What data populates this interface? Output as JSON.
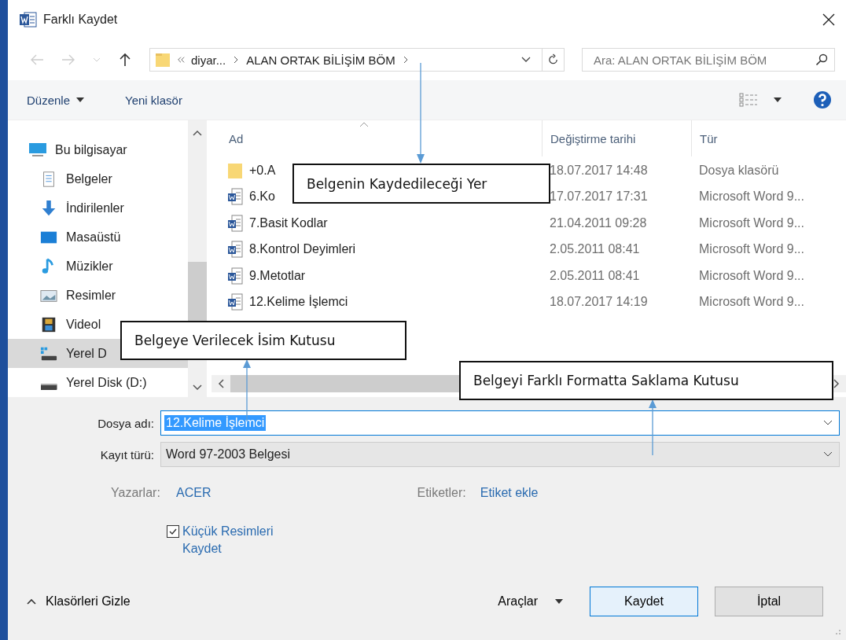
{
  "window": {
    "title": "Farklı Kaydet"
  },
  "address": {
    "segments": [
      "diyar...",
      "ALAN ORTAK BİLİŞİM BÖM"
    ]
  },
  "search": {
    "placeholder": "Ara: ALAN ORTAK BİLİŞİM BÖM"
  },
  "toolbar": {
    "organize": "Düzenle",
    "new_folder": "Yeni klasör"
  },
  "sidebar": {
    "items": [
      {
        "label": "Bu bilgisayar",
        "kind": "computer",
        "selected": false,
        "children": [
          {
            "label": "Belgeler",
            "kind": "documents",
            "selected": false
          },
          {
            "label": "İndirilenler",
            "kind": "download",
            "selected": false
          },
          {
            "label": "Masaüstü",
            "kind": "desktop",
            "selected": false
          },
          {
            "label": "Müzikler",
            "kind": "music",
            "selected": false
          },
          {
            "label": "Resimler",
            "kind": "pictures",
            "selected": false
          },
          {
            "label": "Videol",
            "kind": "videos",
            "selected": false
          },
          {
            "label": "Yerel D",
            "kind": "system-drive",
            "selected": true
          },
          {
            "label": "Yerel Disk (D:)",
            "kind": "drive",
            "selected": false
          }
        ]
      }
    ]
  },
  "table": {
    "columns": [
      "Ad",
      "Değiştirme tarihi",
      "Tür"
    ],
    "rows": [
      {
        "kind": "folder",
        "name": "+0.A",
        "modified": "18.07.2017 14:48",
        "type": "Dosya klasörü"
      },
      {
        "kind": "word",
        "name": "6.Ko",
        "modified": "17.07.2017 17:31",
        "type": "Microsoft Word 9..."
      },
      {
        "kind": "word",
        "name": "7.Basit Kodlar",
        "modified": "21.04.2011 09:28",
        "type": "Microsoft Word 9..."
      },
      {
        "kind": "word",
        "name": "8.Kontrol Deyimleri",
        "modified": "2.05.2011 08:41",
        "type": "Microsoft Word 9..."
      },
      {
        "kind": "word",
        "name": "9.Metotlar",
        "modified": "2.05.2011 08:41",
        "type": "Microsoft Word 9..."
      },
      {
        "kind": "word",
        "name": "12.Kelime İşlemci",
        "modified": "18.07.2017 14:19",
        "type": "Microsoft Word 9..."
      }
    ]
  },
  "form": {
    "filename_label": "Dosya adı:",
    "filename": "12.Kelime İşlemci",
    "type_label": "Kayıt türü:",
    "type": "Word 97-2003 Belgesi",
    "authors_label": "Yazarlar:",
    "authors": "ACER",
    "tags_label": "Etiketler:",
    "tags": "Etiket ekle",
    "thumbnail": {
      "label": "Küçük Resimleri Kaydet",
      "checked": true
    }
  },
  "footer": {
    "hide_folders": "Klasörleri Gizle",
    "tools": "Araçlar",
    "save": "Kaydet",
    "cancel": "İptal"
  },
  "callouts": [
    {
      "text": "Belgenin Kaydedileceği Yer"
    },
    {
      "text": "Belgeye Verilecek İsim Kutusu"
    },
    {
      "text": "Belgeyi Farklı Formatta Saklama Kutusu"
    }
  ]
}
